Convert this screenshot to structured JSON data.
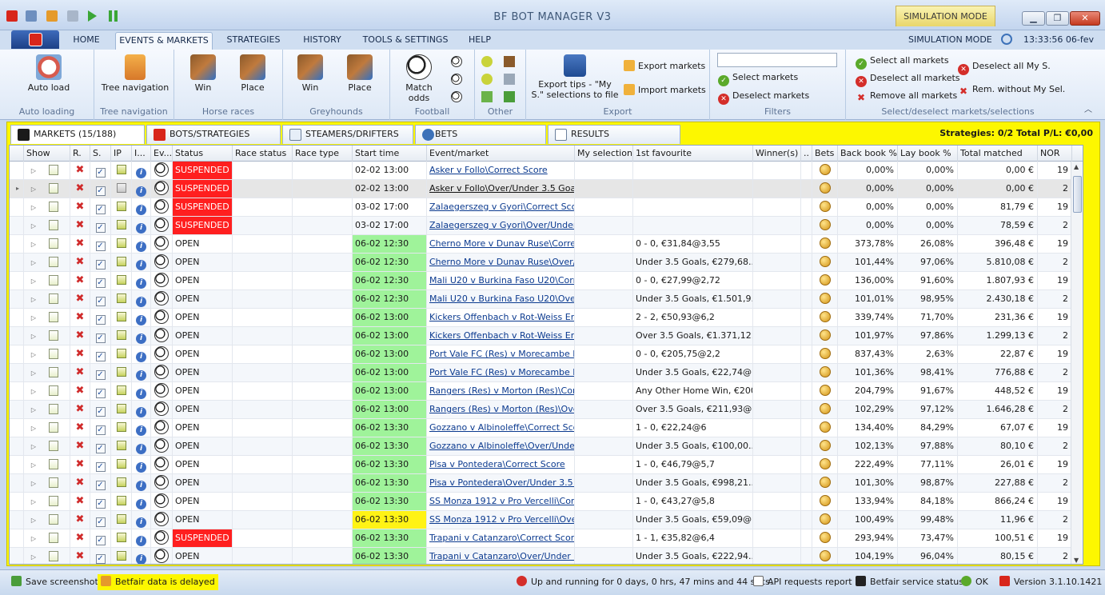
{
  "app": {
    "title": "BF BOT MANAGER V3",
    "sim_tab": "SIMULATION MODE",
    "sim_mode": "SIMULATION MODE",
    "clock": "13:33:56 06-fev"
  },
  "ribbon_tabs": [
    "HOME",
    "EVENTS & MARKETS",
    "STRATEGIES",
    "HISTORY",
    "TOOLS & SETTINGS",
    "HELP"
  ],
  "ribbon": {
    "auto_load": "Auto load",
    "g_auto": "Auto loading",
    "tree_nav": "Tree navigation",
    "g_tree": "Tree navigation",
    "hr_win": "Win",
    "hr_place": "Place",
    "g_horse": "Horse races",
    "gh_win": "Win",
    "gh_place": "Place",
    "g_grey": "Greyhounds",
    "match_odds": "Match odds",
    "g_football": "Football",
    "g_other": "Other",
    "export_tips": "Export tips - \"My S.\" selections to file",
    "export_markets": "Export markets",
    "import_markets": "Import markets",
    "g_export": "Export",
    "select_markets": "Select markets",
    "deselect_markets": "Deselect markets",
    "g_filters": "Filters",
    "select_all": "Select all markets",
    "deselect_all": "Deselect all markets",
    "remove_all": "Remove all markets",
    "deselect_all_mys": "Deselect all My S.",
    "rem_without": "Rem. without My Sel.",
    "g_select": "Select/deselect markets/selections"
  },
  "panel_tabs": [
    "MARKETS (15/188)",
    "BOTS/STRATEGIES",
    "STEAMERS/DRIFTERS",
    "BETS",
    "RESULTS"
  ],
  "strategies_summary": "Strategies: 0/2  Total P/L: €0,00",
  "columns": [
    "Show",
    "R.",
    "S.",
    "IP",
    "I...",
    "Ev...",
    "Status",
    "Race status",
    "Race type",
    "Start time",
    "Event/market",
    "My selections",
    "1st favourite",
    "Winner(s)",
    "..",
    "Bets",
    "Back book %",
    "Lay book %",
    "Total matched",
    "NOR"
  ],
  "rows": [
    {
      "status": "SUSPENDED",
      "start": "02-02 13:00",
      "event": "Asker v Follo\\Correct Score",
      "fav": "",
      "back": "0,00%",
      "lay": "0,00%",
      "matched": "0,00 €",
      "nor": "19"
    },
    {
      "status": "SUSPENDED",
      "start": "02-02 13:00",
      "event": "Asker v Follo\\Over/Under 3.5 Goals",
      "fav": "",
      "back": "0,00%",
      "lay": "0,00%",
      "matched": "0,00 €",
      "nor": "2"
    },
    {
      "status": "SUSPENDED",
      "start": "03-02 17:00",
      "event": "Zalaegerszeg v Gyori\\Correct Score",
      "fav": "",
      "back": "0,00%",
      "lay": "0,00%",
      "matched": "81,79 €",
      "nor": "19"
    },
    {
      "status": "SUSPENDED",
      "start": "03-02 17:00",
      "event": "Zalaegerszeg v Gyori\\Over/Under ...",
      "fav": "",
      "back": "0,00%",
      "lay": "0,00%",
      "matched": "78,59 €",
      "nor": "2"
    },
    {
      "status": "OPEN",
      "start": "06-02 12:30",
      "event": "Cherno More v Dunav Ruse\\Correc...",
      "fav": "0 - 0, €31,84@3,55",
      "back": "373,78%",
      "lay": "26,08%",
      "matched": "396,48 €",
      "nor": "19"
    },
    {
      "status": "OPEN",
      "start": "06-02 12:30",
      "event": "Cherno More v Dunav Ruse\\Over/...",
      "fav": "Under 3.5 Goals, €279,68...",
      "back": "101,44%",
      "lay": "97,06%",
      "matched": "5.810,08 €",
      "nor": "2"
    },
    {
      "status": "OPEN",
      "start": "06-02 12:30",
      "event": "Mali U20 v Burkina Faso U20\\Corre...",
      "fav": "0 - 0, €27,99@2,72",
      "back": "136,00%",
      "lay": "91,60%",
      "matched": "1.807,93 €",
      "nor": "19"
    },
    {
      "status": "OPEN",
      "start": "06-02 12:30",
      "event": "Mali U20 v Burkina Faso U20\\Over/...",
      "fav": "Under 3.5 Goals, €1.501,9...",
      "back": "101,01%",
      "lay": "98,95%",
      "matched": "2.430,18 €",
      "nor": "2"
    },
    {
      "status": "OPEN",
      "start": "06-02 13:00",
      "event": "Kickers Offenbach v Rot-Weiss Erf...",
      "fav": "2 - 2, €50,93@6,2",
      "back": "339,74%",
      "lay": "71,70%",
      "matched": "231,36 €",
      "nor": "19"
    },
    {
      "status": "OPEN",
      "start": "06-02 13:00",
      "event": "Kickers Offenbach v Rot-Weiss Erf...",
      "fav": "Over 3.5 Goals, €1.371,12...",
      "back": "101,97%",
      "lay": "97,86%",
      "matched": "1.299,13 €",
      "nor": "2"
    },
    {
      "status": "OPEN",
      "start": "06-02 13:00",
      "event": "Port Vale FC (Res) v Morecambe F...",
      "fav": "0 - 0, €205,75@2,2",
      "back": "837,43%",
      "lay": "2,63%",
      "matched": "22,87 €",
      "nor": "19"
    },
    {
      "status": "OPEN",
      "start": "06-02 13:00",
      "event": "Port Vale FC (Res) v Morecambe F...",
      "fav": "Under 3.5 Goals, €22,74@...",
      "back": "101,36%",
      "lay": "98,41%",
      "matched": "776,88 €",
      "nor": "2"
    },
    {
      "status": "OPEN",
      "start": "06-02 13:00",
      "event": "Rangers (Res) v Morton (Res)\\Cor...",
      "fav": "Any Other Home Win, €200...",
      "back": "204,79%",
      "lay": "91,67%",
      "matched": "448,52 €",
      "nor": "19"
    },
    {
      "status": "OPEN",
      "start": "06-02 13:00",
      "event": "Rangers (Res) v Morton (Res)\\Ove...",
      "fav": "Over 3.5 Goals, €211,93@...",
      "back": "102,29%",
      "lay": "97,12%",
      "matched": "1.646,28 €",
      "nor": "2"
    },
    {
      "status": "OPEN",
      "start": "06-02 13:30",
      "event": "Gozzano v Albinoleffe\\Correct Score",
      "fav": "1 - 0, €22,24@6",
      "back": "134,40%",
      "lay": "84,29%",
      "matched": "67,07 €",
      "nor": "19"
    },
    {
      "status": "OPEN",
      "start": "06-02 13:30",
      "event": "Gozzano v Albinoleffe\\Over/Under ...",
      "fav": "Under 3.5 Goals, €100,00...",
      "back": "102,13%",
      "lay": "97,88%",
      "matched": "80,10 €",
      "nor": "2"
    },
    {
      "status": "OPEN",
      "start": "06-02 13:30",
      "event": "Pisa v Pontedera\\Correct Score",
      "fav": "1 - 0, €46,79@5,7",
      "back": "222,49%",
      "lay": "77,11%",
      "matched": "26,01 €",
      "nor": "19"
    },
    {
      "status": "OPEN",
      "start": "06-02 13:30",
      "event": "Pisa v Pontedera\\Over/Under 3.5 ...",
      "fav": "Under 3.5 Goals, €998,21...",
      "back": "101,30%",
      "lay": "98,87%",
      "matched": "227,88 €",
      "nor": "2"
    },
    {
      "status": "OPEN",
      "start": "06-02 13:30",
      "event": "SS Monza 1912 v Pro Vercelli\\Corr...",
      "fav": "1 - 0, €43,27@5,8",
      "back": "133,94%",
      "lay": "84,18%",
      "matched": "866,24 €",
      "nor": "19"
    },
    {
      "status": "OPEN",
      "start": "06-02 13:30",
      "event": "SS Monza 1912 v Pro Vercelli\\Over...",
      "fav": "Under 3.5 Goals, €59,09@...",
      "back": "100,49%",
      "lay": "99,48%",
      "matched": "11,96 €",
      "nor": "2"
    },
    {
      "status": "SUSPENDED",
      "start": "06-02 13:30",
      "event": "Trapani v Catanzaro\\Correct Score",
      "fav": "1 - 1, €35,82@6,4",
      "back": "293,94%",
      "lay": "73,47%",
      "matched": "100,51 €",
      "nor": "19"
    },
    {
      "status": "OPEN",
      "start": "06-02 13:30",
      "event": "Trapani v Catanzaro\\Over/Under 3...",
      "fav": "Under 3.5 Goals, €222,94...",
      "back": "104,19%",
      "lay": "96,04%",
      "matched": "80,15 €",
      "nor": "2"
    }
  ],
  "statusbar": {
    "screenshot": "Save screenshot",
    "delayed": "Betfair data is delayed",
    "uptime": "Up and running for 0 days, 0 hrs, 47 mins and 44 secs.",
    "api": "API requests report",
    "service": "Betfair service status",
    "ok": "OK",
    "version": "Version 3.1.10.1421"
  },
  "colors": {
    "suspended": "#ff1f1f",
    "open_time": "#9ff39a",
    "highlight_time": "#fff315",
    "panel": "#fdf700"
  }
}
